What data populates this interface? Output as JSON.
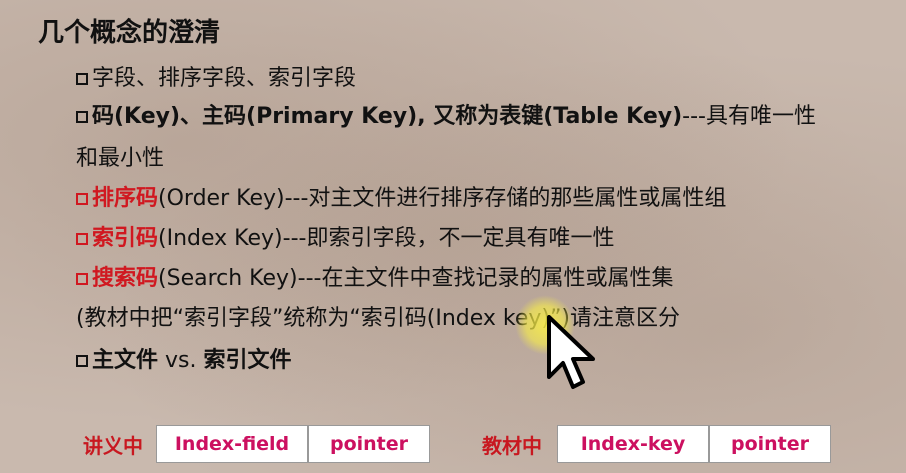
{
  "slide": {
    "title": "几个概念的澄清",
    "items": [
      {
        "text": "字段、排序字段、索引字段"
      },
      {
        "bold": "码(Key)、主码(Primary Key), 又称为表键(Table Key)",
        "rest": "---具有唯一性"
      },
      {
        "text": "和最小性"
      },
      {
        "red": "排序码",
        "rest": "(Order Key)---对主文件进行排序存储的那些属性或属性组"
      },
      {
        "red": "索引码",
        "rest": "(Index Key)---即索引字段，不一定具有唯一性"
      },
      {
        "red": "搜索码",
        "rest": "(Search Key)---在主文件中查找记录的属性或属性集"
      },
      {
        "text": "(教材中把“索引字段”统称为“索引码(Index key)”)请注意区分"
      },
      {
        "bold": "主文件",
        "mid": " vs. ",
        "bold2": "索引文件"
      }
    ],
    "lecture_label": "讲义中",
    "lecture_cells": [
      "Index-field",
      "pointer"
    ],
    "textbook_label": "教材中",
    "textbook_cells": [
      "Index-key",
      "pointer"
    ]
  },
  "colors": {
    "accent_red": "#d01820",
    "cell_text": "#cc1060",
    "cursor_highlight": "#f5e84a"
  }
}
